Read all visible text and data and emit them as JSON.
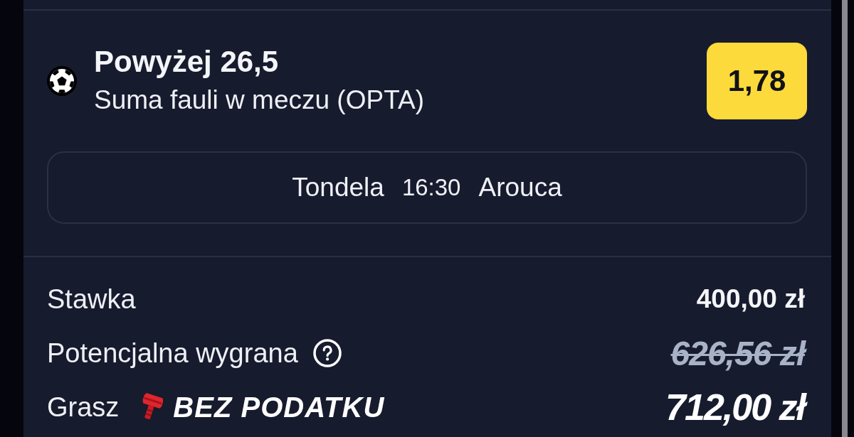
{
  "selection": {
    "title": "Powyżej 26,5",
    "market": "Suma fauli w meczu (OPTA)",
    "odds": "1,78"
  },
  "match": {
    "home": "Tondela",
    "time": "16:30",
    "away": "Arouca"
  },
  "summary": [
    {
      "kind": "amount",
      "label": "Stawka",
      "help": false,
      "value": "400,00 zł"
    },
    {
      "kind": "struck",
      "label": "Potencjalna wygrana",
      "help": true,
      "value": "626,56 zł"
    },
    {
      "kind": "promo",
      "label": "Grasz",
      "help": false,
      "badge": "BEZ PODATKU",
      "value": "712,00 zł"
    }
  ]
}
